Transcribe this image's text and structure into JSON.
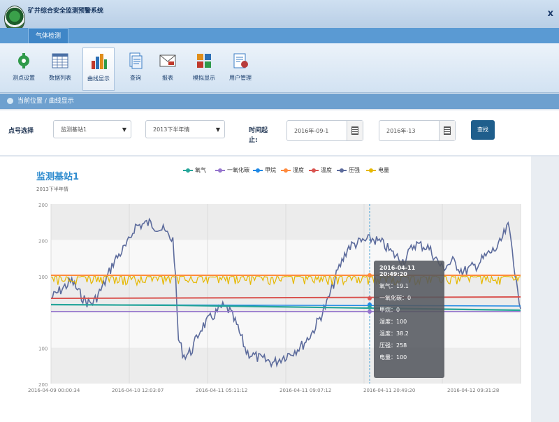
{
  "window": {
    "title": "矿井综合安全监测预警系统",
    "close": "x"
  },
  "tabs": [
    {
      "label": "气体检测"
    }
  ],
  "toolbar": [
    {
      "label": "测点设置",
      "icon": "settings-icon",
      "color": "#2f9a4a"
    },
    {
      "label": "数据列表",
      "icon": "table-icon",
      "color": "#4a6fa5"
    },
    {
      "label": "曲线显示",
      "icon": "bar-chart-icon",
      "color": "#c0392b"
    },
    {
      "label": "查询",
      "icon": "document-icon",
      "color": "#3b7dc4"
    },
    {
      "label": "报表",
      "icon": "mail-icon",
      "color": "#c0392b"
    },
    {
      "label": "模拟显示",
      "icon": "palette-icon",
      "color": "#e08e1b"
    },
    {
      "label": "用户管理",
      "icon": "user-management-icon",
      "color": "#b83c3c"
    }
  ],
  "breadcrumb": "当前位置 / 曲线显示",
  "filters": {
    "point_label": "点号选择",
    "point_value": "监测基站1",
    "sensor_value": "2013下半年情",
    "time_label": "时间起止:",
    "start_date": "2016年-09-1",
    "end_date": "2016年-13",
    "query_label": "查找"
  },
  "chart": {
    "title": "监测基站1",
    "subtitle": "2013下半年情"
  },
  "chart_data": {
    "type": "line",
    "y_ticks": [
      "200",
      "200",
      "100",
      "",
      "100",
      "200"
    ],
    "x_ticks": [
      "2016-04-09 00:00:34",
      "2016-04-10 12:03:07",
      "2016-04-11 05:11:12",
      "2016-04-11 09:07:12",
      "2016-04-11 20:49:20",
      "2016-04-12 09:31:28"
    ],
    "series": [
      {
        "name": "氧气",
        "color": "#26a69a"
      },
      {
        "name": "一氧化碳",
        "color": "#9575cd"
      },
      {
        "name": "甲烷",
        "color": "#1e88e5"
      },
      {
        "name": "湿度",
        "color": "#ff8a3d"
      },
      {
        "name": "温度",
        "color": "#d9534f"
      },
      {
        "name": "压强",
        "color": "#5c6b9c"
      },
      {
        "name": "电量",
        "color": "#e6b800"
      }
    ],
    "grid": true,
    "legend": "top-center"
  },
  "tooltip": {
    "title": "2016-04-11 20:49:20",
    "rows": [
      "氧气：19.1",
      "一氧化碳：0",
      "甲烷：0",
      "湿度：100",
      "温度：38.2",
      "压强：258",
      "电量：100"
    ]
  }
}
